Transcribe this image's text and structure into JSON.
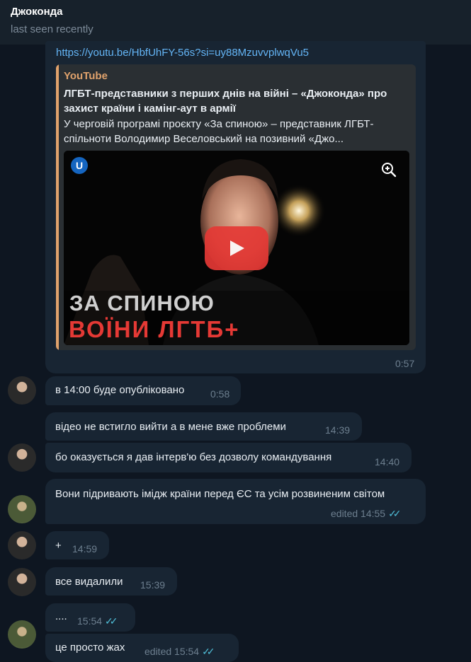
{
  "header": {
    "name": "Джоконда",
    "status": "last seen recently"
  },
  "message_link": {
    "url": "https://youtu.be/HbfUhFY-56s?si=uy88MzuvvplwqVu5",
    "preview_site": "YouTube",
    "preview_title": "ЛГБТ-представники з перших днів на війні –  «Джоконда» про захист країни і камінг-аут в армії",
    "preview_desc": "У черговій програмі проєкту «За спиною» – представник ЛГБТ-спільноти Володимир Веселовський на позивний «Джо...",
    "thumb_logo": "U",
    "thumb_line1": "ЗА СПИНОЮ",
    "thumb_line2": "ВОЇНИ ЛГТБ+",
    "time": "0:57"
  },
  "messages": [
    {
      "text": "в 14:00 буде опубліковано",
      "time": "0:58"
    },
    {
      "text": "відео не встигло вийти а в мене вже проблеми",
      "time": "14:39"
    },
    {
      "text": "бо оказується я дав інтерв'ю без дозволу командування",
      "time": "14:40"
    },
    {
      "text": "Вони підривають імідж країни перед ЄС та усім розвиненим світом",
      "time": "edited 14:55"
    },
    {
      "text": "+",
      "time": "14:59"
    },
    {
      "text": "все видалили",
      "time": "15:39"
    },
    {
      "text": "....",
      "time": "15:54"
    },
    {
      "text": "це просто жах",
      "time": "edited 15:54"
    }
  ],
  "icons": {
    "zoom": "zoom-in-icon",
    "play": "play-icon",
    "read": "double-check-icon"
  },
  "colors": {
    "background": "#0e1621",
    "bubble": "#182533",
    "accent_link": "#64b5f6",
    "site_name": "#e0a26c",
    "play_button": "#e53935"
  }
}
